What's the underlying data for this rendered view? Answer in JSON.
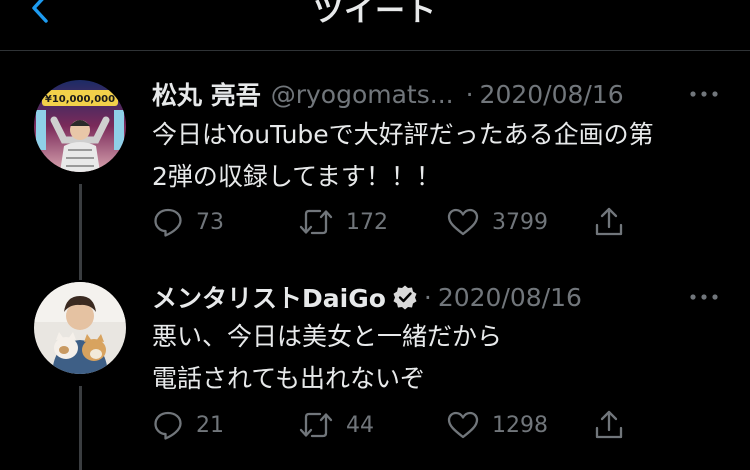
{
  "header": {
    "title": "ツイート"
  },
  "tweets": [
    {
      "display_name": "松丸 亮吾",
      "handle": "@ryogomats...",
      "separator": "·",
      "date": "2020/08/16",
      "text_lines": [
        "今日はYouTubeで大好評だったある企画の第",
        "2弾の収録してます！！！"
      ],
      "counts": {
        "replies": "73",
        "retweets": "172",
        "likes": "3799"
      },
      "verified": false,
      "avatar_text": "¥10,000,000"
    },
    {
      "display_name": "メンタリストDaiGo",
      "handle": "",
      "separator": "·",
      "date": "2020/08/16",
      "text_lines": [
        "悪い、今日は美女と一緒だから",
        "電話されても出れないぞ"
      ],
      "counts": {
        "replies": "21",
        "retweets": "44",
        "likes": "1298"
      },
      "verified": true
    }
  ],
  "colors": {
    "background": "#000000",
    "text": "#e7e9ea",
    "muted": "#71767b",
    "accent": "#1d9bf0"
  }
}
